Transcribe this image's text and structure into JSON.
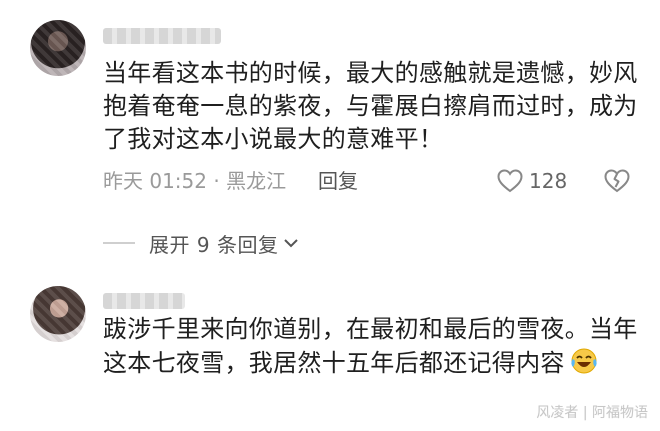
{
  "comments": [
    {
      "text": "当年看这本书的时候，最大的感触就是遗憾，妙风抱着奄奄一息的紫夜，与霍展白擦肩而过时，成为了我对这本小说最大的意难平！",
      "time": "昨天 01:52",
      "location": "黑龙江",
      "reply_label": "回复",
      "likes": "128"
    },
    {
      "text": "跋涉千里来向你道别，在最初和最后的雪夜。当年这本七夜雪，我居然十五年后都还记得内容"
    }
  ],
  "expand_label": "展开 9 条回复",
  "watermark": "风凌者 | 阿福物语",
  "icons": {
    "like": "heart-outline-icon",
    "dislike": "broken-heart-icon",
    "expand": "chevron-down-icon",
    "emoji": "laughing-tears-emoji"
  }
}
